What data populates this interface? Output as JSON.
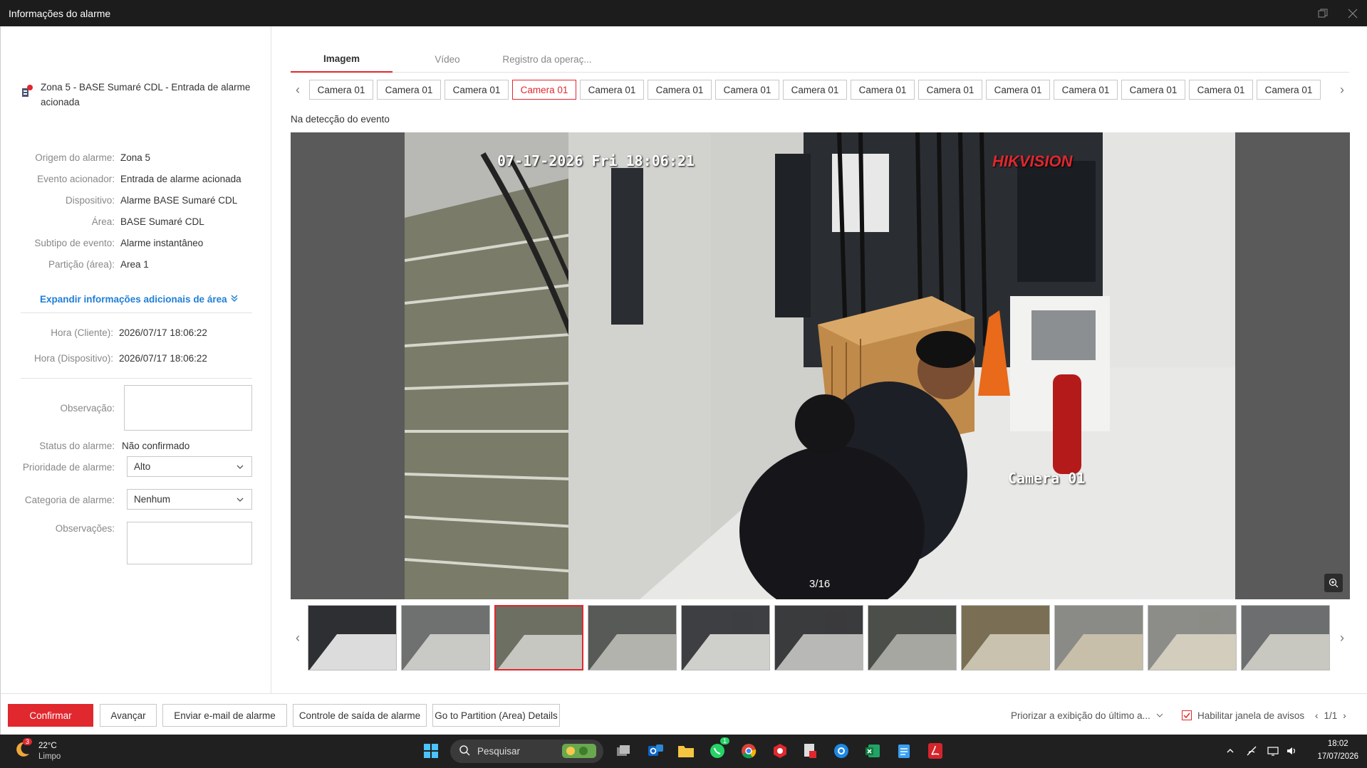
{
  "window": {
    "title": "Informações do alarme"
  },
  "alarm": {
    "header": "Zona 5 - BASE Sumaré CDL - Entrada de alarme acionada",
    "fields": [
      {
        "label": "Origem do alarme:",
        "value": "Zona 5"
      },
      {
        "label": "Evento acionador:",
        "value": "Entrada de alarme acionada"
      },
      {
        "label": "Dispositivo:",
        "value": "Alarme BASE Sumaré CDL"
      },
      {
        "label": "Área:",
        "value": "BASE Sumaré CDL"
      },
      {
        "label": "Subtipo de evento:",
        "value": "Alarme instantâneo"
      },
      {
        "label": "Partição (área):",
        "value": "Area 1"
      }
    ],
    "expand_label": "Expandir informações adicionais de área",
    "time_client_label": "Hora (Cliente):",
    "time_client": "2026/07/17 18:06:22",
    "time_device_label": "Hora (Dispositivo):",
    "time_device": "2026/07/17 18:06:22",
    "observation_label": "Observação:",
    "status_label": "Status do alarme:",
    "status_value": "Não confirmado",
    "priority_label": "Prioridade de alarme:",
    "priority_value": "Alto",
    "category_label": "Categoria de alarme:",
    "category_value": "Nenhum",
    "observations_label": "Observações:"
  },
  "tabs": [
    "Imagem",
    "Vídeo",
    "Registro da operaç..."
  ],
  "cameras": [
    "Camera 01",
    "Camera 01",
    "Camera 01",
    "Camera 01",
    "Camera 01",
    "Camera 01",
    "Camera 01",
    "Camera 01",
    "Camera 01",
    "Camera 01",
    "Camera 01",
    "Camera 01",
    "Camera 01",
    "Camera 01",
    "Camera 01"
  ],
  "active_camera_index": 3,
  "event_label": "Na detecção do evento",
  "viewer": {
    "timestamp": "07-17-2026 Fri 18:06:21",
    "brand": "HIKVISION",
    "camera_name": "Camera 01",
    "counter": "3/16"
  },
  "thumbnail_count": 11,
  "active_thumbnail_index": 2,
  "buttons": {
    "confirm": "Confirmar",
    "advance": "Avançar",
    "email": "Enviar e-mail de alarme",
    "output": "Controle de saída de alarme",
    "partition": "Go to Partition (Area) Details"
  },
  "bottom_right": {
    "prioritize": "Priorizar a exibição do último a...",
    "enable_popup": "Habilitar janela de avisos",
    "pages": "1/1"
  },
  "taskbar": {
    "temperature": "22°C",
    "weather": "Limpo",
    "weather_badge": "3",
    "search_placeholder": "Pesquisar",
    "whatsapp_badge": "1",
    "time": "18:02",
    "date": "17/07/2026"
  },
  "colors": {
    "accent": "#e0282e",
    "link": "#1f7fd6",
    "titlebar": "#1c1c1c",
    "taskbar": "#202020"
  }
}
